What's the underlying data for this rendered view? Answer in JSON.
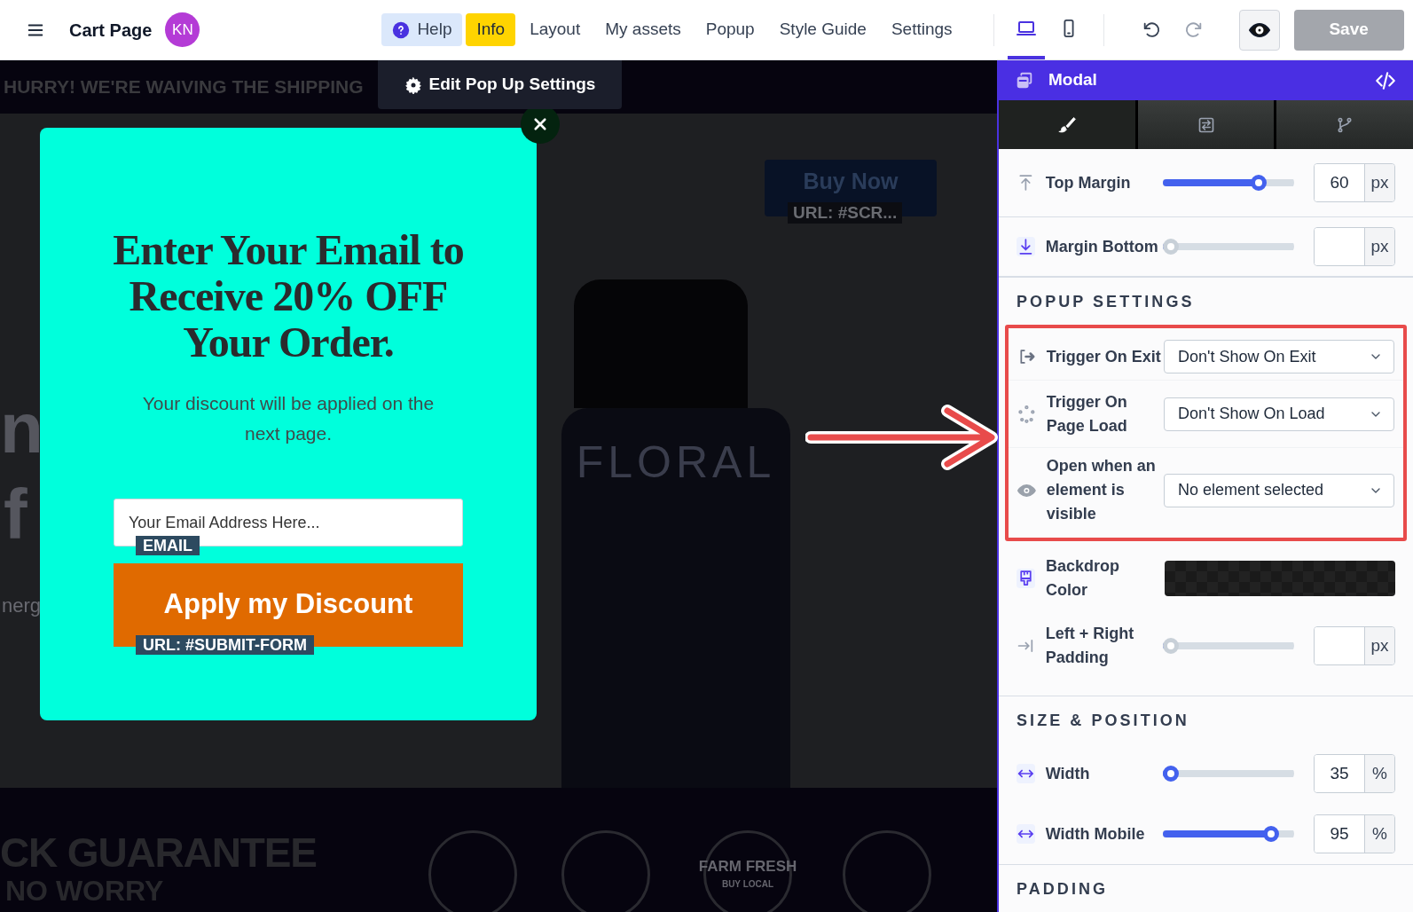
{
  "topbar": {
    "page_title": "Cart Page",
    "avatar": "KN",
    "nav": [
      {
        "label": "Help",
        "kind": "help",
        "selected": false
      },
      {
        "label": "Info",
        "kind": "link",
        "selected": true
      },
      {
        "label": "Layout",
        "kind": "link",
        "selected": false
      },
      {
        "label": "My assets",
        "kind": "link",
        "selected": false
      },
      {
        "label": "Popup",
        "kind": "link",
        "selected": false
      },
      {
        "label": "Style Guide",
        "kind": "link",
        "selected": false
      },
      {
        "label": "Settings",
        "kind": "link",
        "selected": false
      }
    ],
    "devices": [
      {
        "kind": "desktop",
        "selected": true
      },
      {
        "kind": "mobile",
        "selected": false
      }
    ],
    "save": {
      "label": "Save",
      "disabled": true
    }
  },
  "canvas": {
    "banner": "HURRY! WE'RE WAIVING THE SHIPPING",
    "edit_tab": "Edit Pop Up Settings",
    "buy_now": {
      "label": "Buy Now",
      "tag": "URL: #SCR..."
    },
    "bottle_label": "FLORAL",
    "fragments": [
      "n",
      "f",
      "nerg"
    ],
    "footer": {
      "heading": "CK GUARANTEE",
      "subheading": "NO WORRY",
      "badge_text": "FARM FRESH",
      "badge_subtext": "BUY LOCAL"
    }
  },
  "popup": {
    "heading": "Enter Your Email to Receive 20% OFF Your Order.",
    "body": "Your discount will be applied on the next page.",
    "email": {
      "placeholder": "Your Email Address Here...",
      "tag": "EMAIL"
    },
    "button": {
      "label": "Apply my Discount",
      "tag": "URL: #SUBMIT-FORM"
    }
  },
  "panel": {
    "title": "Modal",
    "tabs": [
      {
        "selected": true
      },
      {
        "selected": false
      },
      {
        "selected": false
      }
    ],
    "sections": [
      {
        "rows": [
          {
            "kind": "slider",
            "label": "Top Margin",
            "level": 0.76,
            "value": "60",
            "unit": "px"
          },
          {
            "kind": "slider",
            "label": "Margin Bottom",
            "level": 0,
            "unit": "px"
          }
        ]
      },
      {
        "heading": "POPUP SETTINGS",
        "highlighted_rows": [
          {
            "kind": "select",
            "label": "Trigger On Exit",
            "value": "Don't Show On Exit"
          },
          {
            "kind": "select",
            "label": "Trigger On Page Load",
            "value": "Don't Show On Load"
          },
          {
            "kind": "select",
            "label": "Open when an element is visible",
            "value": "No element selected"
          }
        ],
        "rows": [
          {
            "kind": "color",
            "label": "Backdrop Color"
          },
          {
            "kind": "slider",
            "label": "Left + Right Padding",
            "level": 0,
            "unit": "px"
          }
        ]
      },
      {
        "heading": "SIZE & POSITION",
        "rows": [
          {
            "kind": "slider",
            "label": "Width",
            "level": 0,
            "value": "35",
            "unit": "%"
          },
          {
            "kind": "slider",
            "label": "Width Mobile",
            "level": 0.87,
            "value": "95",
            "unit": "%"
          }
        ]
      },
      {
        "heading": "PADDING"
      }
    ]
  }
}
